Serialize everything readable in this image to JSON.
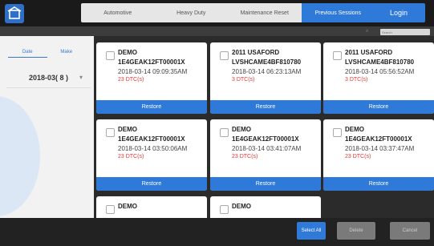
{
  "topbar": {
    "home_icon": "home-icon",
    "tabs": [
      {
        "label": "Automotive",
        "active": false
      },
      {
        "label": "Heavy Duty",
        "active": false
      },
      {
        "label": "Maintenance Reset",
        "active": false
      },
      {
        "label": "Previous Sessions",
        "active": true
      }
    ],
    "login_label": "Login"
  },
  "search": {
    "placeholder": "Search"
  },
  "sidebar": {
    "segment": [
      {
        "label": "Date",
        "selected": true
      },
      {
        "label": "Make",
        "selected": false
      }
    ],
    "date_value": "2018-03( 8 )",
    "caret": "▾"
  },
  "cards": [
    {
      "make": "DEMO",
      "vin": "1E4GEAK12FT00001X",
      "timestamp": "2018-03-14 09:09:35AM",
      "dtc": "23 DTC(s)",
      "restore": "Restore"
    },
    {
      "make": "2011 USAFORD",
      "vin": "LVSHCAME4BF810780",
      "timestamp": "2018-03-14 06:23:13AM",
      "dtc": "3 DTC(s)",
      "restore": "Restore"
    },
    {
      "make": "2011 USAFORD",
      "vin": "LVSHCAME4BF810780",
      "timestamp": "2018-03-14 05:56:52AM",
      "dtc": "3 DTC(s)",
      "restore": "Restore"
    },
    {
      "make": "DEMO",
      "vin": "1E4GEAK12FT00001X",
      "timestamp": "2018-03-14 03:50:06AM",
      "dtc": "23 DTC(s)",
      "restore": "Restore"
    },
    {
      "make": "DEMO",
      "vin": "1E4GEAK12FT00001X",
      "timestamp": "2018-03-14 03:41:07AM",
      "dtc": "23 DTC(s)",
      "restore": "Restore"
    },
    {
      "make": "DEMO",
      "vin": "1E4GEAK12FT00001X",
      "timestamp": "2018-03-14 03:37:47AM",
      "dtc": "23 DTC(s)",
      "restore": "Restore"
    },
    {
      "make": "DEMO",
      "vin": "",
      "timestamp": "",
      "dtc": "",
      "restore": ""
    },
    {
      "make": "DEMO",
      "vin": "",
      "timestamp": "",
      "dtc": "",
      "restore": ""
    }
  ],
  "bottombar": {
    "select_all": "Select All",
    "delete": "Delete",
    "cancel": "Cancel"
  },
  "colors": {
    "accent": "#2f7ad9",
    "dtc_red": "#e53935"
  }
}
